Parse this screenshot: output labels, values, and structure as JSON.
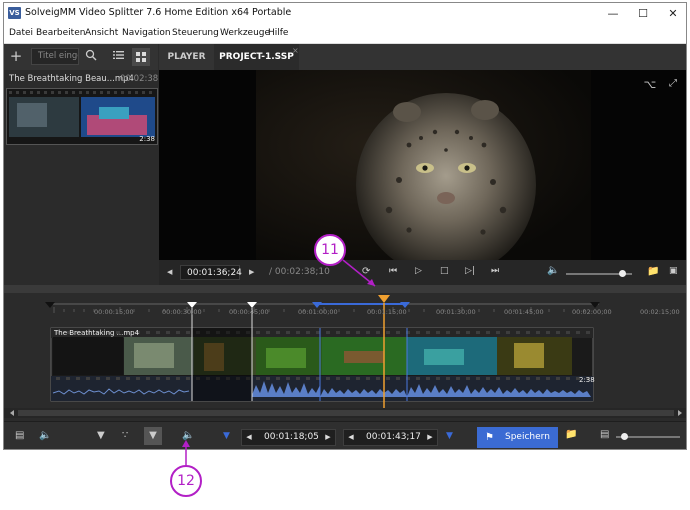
{
  "window": {
    "title": "SolveigMM Video Splitter 7.6 Home Edition x64 Portable",
    "app_icon_text": "VS"
  },
  "menu": [
    "Datei",
    "Bearbeiten",
    "Ansicht",
    "Navigation",
    "Steuerung",
    "Werkzeuge",
    "Hilfe"
  ],
  "left_panel": {
    "search_placeholder": "Titel eingeben",
    "media_item": {
      "title": "The Breathtaking Beau...mp4",
      "duration": "00:02:38",
      "thumb_duration": "2:38"
    }
  },
  "tabs": [
    "PLAYER",
    "PROJECT-1.SSP"
  ],
  "player": {
    "current_time": "00:01:36;24",
    "total_time": "/ 00:02:38;10",
    "volume": 0.85
  },
  "timeline": {
    "ruler_labels": [
      "00:00:15;00",
      "00:00:30;00",
      "00:00:45;00",
      "00:01:00;00",
      "00:01:15;00",
      "00:01:30;00",
      "00:01:45;00",
      "00:02:00;00",
      "00:02:15;00"
    ],
    "clip_title": "The Breathtaking ...mp4",
    "clip_duration": "2:38"
  },
  "bottom": {
    "start_time": "00:01:18;05",
    "end_time": "00:01:43;17",
    "save_label": "Speichern",
    "zoom": 0.12
  },
  "callouts": [
    "11",
    "12"
  ],
  "colors": {
    "accent_blue": "#3b6bd3",
    "marker_orange": "#f0a030",
    "callout_purple": "#b21fc6",
    "selection_blue": "#3355cc"
  }
}
